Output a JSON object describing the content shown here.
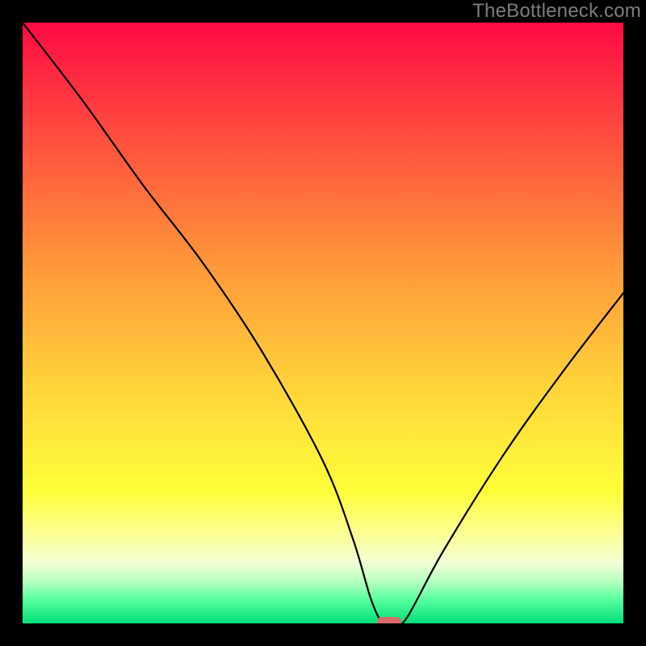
{
  "watermark": "TheBottleneck.com",
  "chart_data": {
    "type": "line",
    "title": "",
    "xlabel": "",
    "ylabel": "",
    "xlim": [
      0,
      100
    ],
    "ylim": [
      0,
      100
    ],
    "series": [
      {
        "name": "bottleneck-curve",
        "x": [
          0,
          10,
          20,
          30,
          40,
          50,
          55,
          58,
          60,
          62,
          64,
          70,
          80,
          90,
          100
        ],
        "values": [
          100,
          87,
          73,
          60,
          45,
          27,
          14,
          4,
          0,
          0,
          1,
          12,
          28,
          42,
          55
        ]
      }
    ],
    "marker": {
      "x": 61,
      "y": 0,
      "color": "#d86b6b"
    },
    "gradient_stops": [
      {
        "offset": 0.0,
        "color": "#ff0a45"
      },
      {
        "offset": 0.18,
        "color": "#ff4a3e"
      },
      {
        "offset": 0.4,
        "color": "#ff963a"
      },
      {
        "offset": 0.6,
        "color": "#ffd23a"
      },
      {
        "offset": 0.78,
        "color": "#ffff3a"
      },
      {
        "offset": 0.86,
        "color": "#fbffa0"
      },
      {
        "offset": 0.9,
        "color": "#f2ffd6"
      },
      {
        "offset": 0.93,
        "color": "#b7ffc0"
      },
      {
        "offset": 0.96,
        "color": "#58ff9e"
      },
      {
        "offset": 1.0,
        "color": "#00e07a"
      }
    ]
  }
}
